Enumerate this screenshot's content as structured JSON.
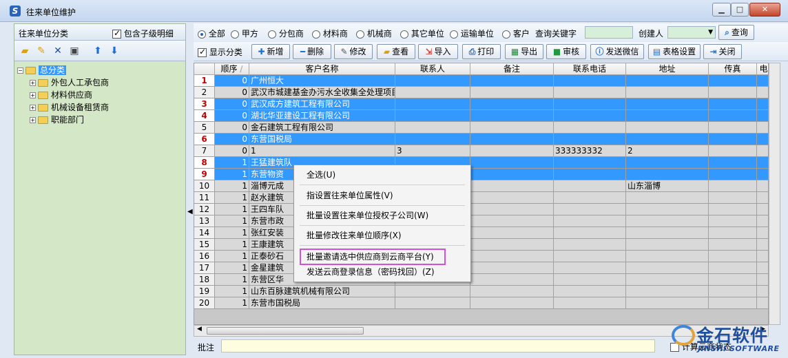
{
  "window": {
    "title": "往来单位维护"
  },
  "left_panel": {
    "title": "往来单位分类",
    "include_sub_label": "包含子级明细",
    "include_sub_checked": true,
    "tree": {
      "root": "总分类",
      "children": [
        "外包人工承包商",
        "材料供应商",
        "机械设备租赁商",
        "职能部门"
      ]
    }
  },
  "filter": {
    "options": [
      "全部",
      "甲方",
      "分包商",
      "材料商",
      "机械商",
      "其它单位",
      "运输单位",
      "客户"
    ],
    "selected": "全部",
    "keyword_label": "查询关键字",
    "keyword_value": "",
    "creator_label": "创建人",
    "creator_value": "",
    "query_button": "查询"
  },
  "toolbar": {
    "show_category_label": "显示分类",
    "show_category_checked": true,
    "buttons": [
      "新增",
      "删除",
      "修改",
      "查看",
      "导入",
      "打印",
      "导出",
      "审核",
      "发送微信",
      "表格设置",
      "关闭"
    ]
  },
  "grid": {
    "columns": [
      "顺序",
      "客户名称",
      "联系人",
      "备注",
      "联系电话",
      "地址",
      "传真",
      "电"
    ],
    "rows": [
      {
        "num": "1",
        "order": "0",
        "name": "广州恒大",
        "contact": "",
        "remark": "",
        "phone": "",
        "address": "",
        "fax": "",
        "selected": true
      },
      {
        "num": "2",
        "order": "0",
        "name": "武汉市城建基金办污水全收集全处理项目",
        "contact": "",
        "remark": "",
        "phone": "",
        "address": "",
        "fax": "",
        "selected": false
      },
      {
        "num": "3",
        "order": "0",
        "name": "武汉成方建筑工程有限公司",
        "contact": "",
        "remark": "",
        "phone": "",
        "address": "",
        "fax": "",
        "selected": true
      },
      {
        "num": "4",
        "order": "0",
        "name": "湖北华亚建设工程有限公司",
        "contact": "",
        "remark": "",
        "phone": "",
        "address": "",
        "fax": "",
        "selected": true
      },
      {
        "num": "5",
        "order": "0",
        "name": "金石建筑工程有限公司",
        "contact": "",
        "remark": "",
        "phone": "",
        "address": "",
        "fax": "",
        "selected": false
      },
      {
        "num": "6",
        "order": "0",
        "name": "东营国税局",
        "contact": "",
        "remark": "",
        "phone": "",
        "address": "",
        "fax": "",
        "selected": true
      },
      {
        "num": "7",
        "order": "0",
        "name": "1",
        "contact": "3",
        "remark": "",
        "phone": "333333332",
        "address": "2",
        "fax": "",
        "selected": false
      },
      {
        "num": "8",
        "order": "1",
        "name": "王猛建筑队",
        "contact": "",
        "remark": "",
        "phone": "",
        "address": "",
        "fax": "",
        "selected": true
      },
      {
        "num": "9",
        "order": "1",
        "name": "东营物资",
        "contact": "",
        "remark": "",
        "phone": "",
        "address": "",
        "fax": "",
        "selected": true
      },
      {
        "num": "10",
        "order": "1",
        "name": "淄博元成",
        "contact": "",
        "remark": "",
        "phone": "",
        "address": "山东淄博",
        "fax": "",
        "selected": false
      },
      {
        "num": "11",
        "order": "1",
        "name": "赵水建筑",
        "contact": "",
        "remark": "",
        "phone": "",
        "address": "",
        "fax": "",
        "selected": false
      },
      {
        "num": "12",
        "order": "1",
        "name": "王四车队",
        "contact": "",
        "remark": "",
        "phone": "",
        "address": "",
        "fax": "",
        "selected": false
      },
      {
        "num": "13",
        "order": "1",
        "name": "东营市政",
        "contact": "",
        "remark": "",
        "phone": "",
        "address": "",
        "fax": "",
        "selected": false
      },
      {
        "num": "14",
        "order": "1",
        "name": "张红安装",
        "contact": "",
        "remark": "",
        "phone": "",
        "address": "",
        "fax": "",
        "selected": false
      },
      {
        "num": "15",
        "order": "1",
        "name": "王康建筑",
        "contact": "",
        "remark": "",
        "phone": "",
        "address": "",
        "fax": "",
        "selected": false
      },
      {
        "num": "16",
        "order": "1",
        "name": "正泰砂石",
        "contact": "",
        "remark": "",
        "phone": "",
        "address": "",
        "fax": "",
        "selected": false
      },
      {
        "num": "17",
        "order": "1",
        "name": "金星建筑",
        "contact": "",
        "remark": "",
        "phone": "",
        "address": "",
        "fax": "",
        "selected": false
      },
      {
        "num": "18",
        "order": "1",
        "name": "东营区华",
        "contact": "",
        "remark": "",
        "phone": "",
        "address": "",
        "fax": "",
        "selected": false
      },
      {
        "num": "19",
        "order": "1",
        "name": "山东百脉建筑机械有限公司",
        "contact": "",
        "remark": "",
        "phone": "",
        "address": "",
        "fax": "",
        "selected": false
      },
      {
        "num": "20",
        "order": "1",
        "name": "东营市国税局",
        "contact": "",
        "remark": "",
        "phone": "",
        "address": "",
        "fax": "",
        "selected": false
      }
    ]
  },
  "context_menu": {
    "items": [
      "全选(U)",
      "指设置往来单位属性(V)",
      "批量设置往来单位授权子公司(W)",
      "批量修改往来单位顺序(X)",
      "批量邀请选中供应商到云商平台(Y)",
      "发送云商登录信息（密码找回）(Z)"
    ],
    "highlighted": "批量邀请选中供应商到云商平台(Y)"
  },
  "bottom": {
    "remark_label": "批注",
    "remark_value": "",
    "cloud_status_label": "计算云商状态"
  },
  "watermark": {
    "cn": "金石软件",
    "en": "JINSHI SOFTWARE"
  },
  "colors": {
    "selection": "#3399ff",
    "tree_bg": "#d4e7c6",
    "menu_highlight": "#d64fd8"
  }
}
